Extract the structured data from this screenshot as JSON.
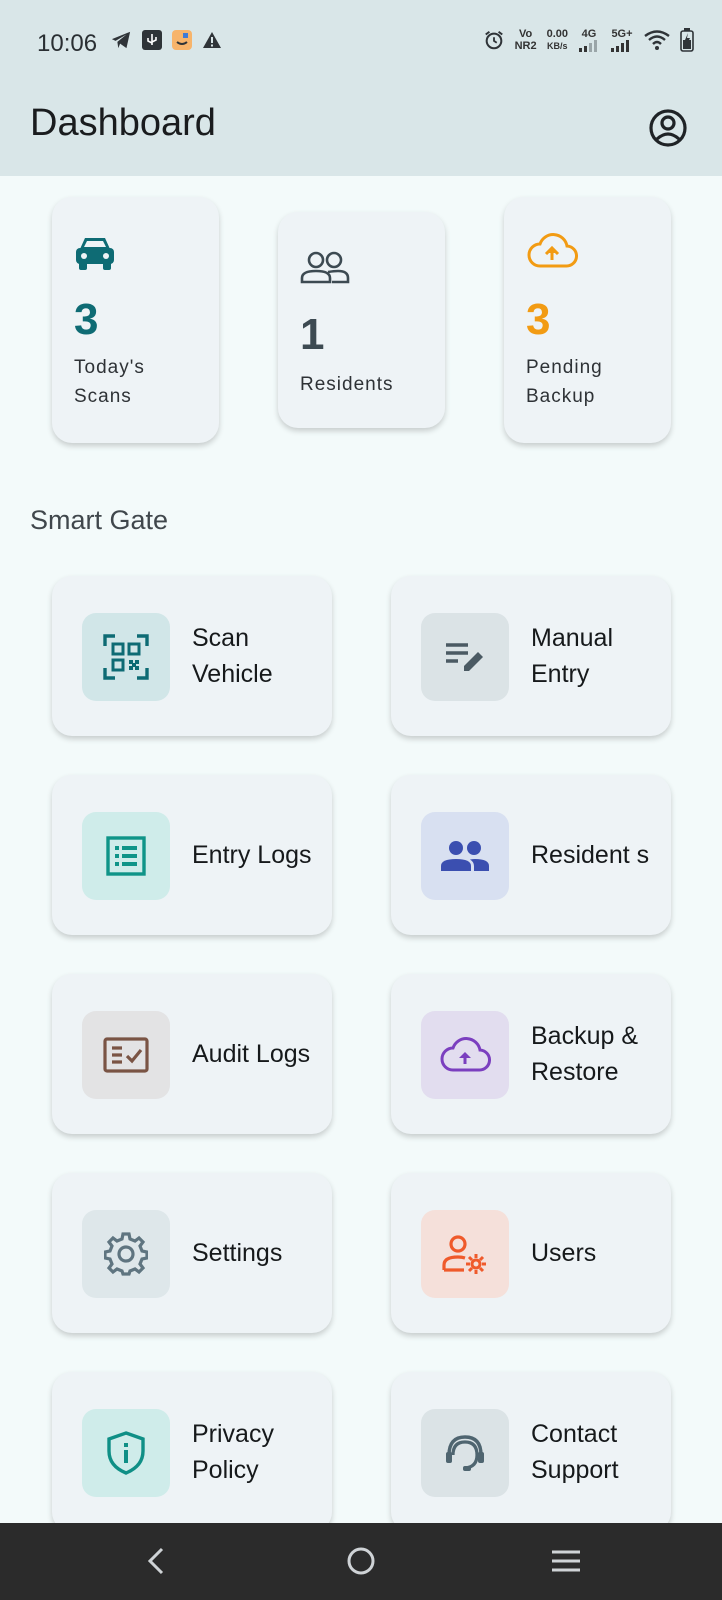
{
  "status": {
    "time": "10:06",
    "volte_top": "Vo",
    "volte_bottom": "NR2",
    "speed_value": "0.00",
    "speed_unit": "KB/s",
    "net1": "4G",
    "net2": "5G+"
  },
  "header": {
    "title": "Dashboard"
  },
  "stats": [
    {
      "value": "3",
      "label": "Today's Scans",
      "color": "#0e6b74",
      "icon": "car-icon"
    },
    {
      "value": "1",
      "label": "Residents",
      "color": "#3d4a52",
      "icon": "group-icon"
    },
    {
      "value": "3",
      "label": "Pending Backup",
      "color": "#f29b13",
      "icon": "cloud-upload-icon"
    }
  ],
  "section": {
    "title": "Smart Gate"
  },
  "tiles": [
    {
      "label": "Scan Vehicle",
      "icon": "qr-scan-icon",
      "color": "#0e6b74",
      "bg": "#d1e6e8"
    },
    {
      "label": "Manual Entry",
      "icon": "edit-note-icon",
      "color": "#4b5a63",
      "bg": "#dbe3e6"
    },
    {
      "label": "Entry Logs",
      "icon": "list-alt-icon",
      "color": "#0f9488",
      "bg": "#cfecea"
    },
    {
      "label": "Resident s",
      "icon": "people-icon",
      "color": "#3b4fb0",
      "bg": "#d8e0f1"
    },
    {
      "label": "Audit Logs",
      "icon": "fact-check-icon",
      "color": "#7a5444",
      "bg": "#e3e3e4"
    },
    {
      "label": "Backup & Restore",
      "icon": "cloud-upload-icon",
      "color": "#7b3fbf",
      "bg": "#e2ddef"
    },
    {
      "label": "Settings",
      "icon": "gear-icon",
      "color": "#5f7580",
      "bg": "#dee7ea"
    },
    {
      "label": "Users",
      "icon": "manage-accounts-icon",
      "color": "#ef5a2b",
      "bg": "#f5e0da"
    },
    {
      "label": "Privacy Policy",
      "icon": "shield-info-icon",
      "color": "#0f8f86",
      "bg": "#cfecea"
    },
    {
      "label": "Contact Support",
      "icon": "support-agent-icon",
      "color": "#4f6570",
      "bg": "#dbe3e6"
    }
  ]
}
